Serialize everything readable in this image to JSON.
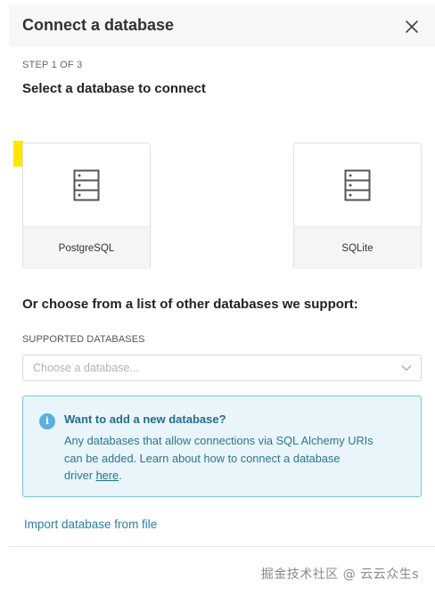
{
  "header": {
    "title": "Connect a database",
    "close_icon": "close-icon"
  },
  "step": {
    "indicator": "STEP 1 OF 3",
    "title": "Select a database to connect"
  },
  "cards": [
    {
      "label": "PostgreSQL",
      "icon": "database-server-icon"
    },
    {
      "label": "SQLite",
      "icon": "database-server-icon"
    }
  ],
  "other": {
    "title": "Or choose from a list of other databases we support:",
    "supported_label": "SUPPORTED DATABASES",
    "select_placeholder": "Choose a database..."
  },
  "info": {
    "icon": "info-icon",
    "icon_glyph": "i",
    "title": "Want to add a new database?",
    "line1": "Any databases that allow connections via SQL Alchemy URIs",
    "line2": "can be added. Learn about how to connect a database",
    "line3_prefix": "driver ",
    "link_text": "here",
    "line3_suffix": "."
  },
  "footer": {
    "import_link": "Import database from file"
  },
  "watermark": "掘金技术社区 @ 云云众生s",
  "colors": {
    "accent": "#5aaee0",
    "info_border": "#7ac4de",
    "info_bg": "#e9f5fa",
    "highlight": "#ffe600",
    "link": "#2a7ea8"
  }
}
